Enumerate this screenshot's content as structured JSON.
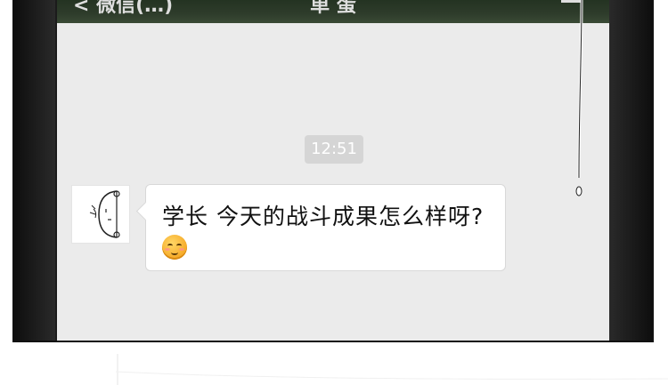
{
  "nav": {
    "back_label": "< 微信(…)",
    "title": "单 蛋"
  },
  "chat": {
    "timestamp": "12:51",
    "message_text": "学长 今天的战斗成果怎么样呀?",
    "message_emoji": "smiling-face-emoji",
    "avatar_icon": "cartoon-peeking-face-icon"
  },
  "colors": {
    "screen_bg": "#ebebeb",
    "nav_bg": "#2e3c2b",
    "bubble_bg": "#ffffff",
    "timestamp_bg": "#d5d5d5",
    "frame": "#1b1b1b"
  }
}
